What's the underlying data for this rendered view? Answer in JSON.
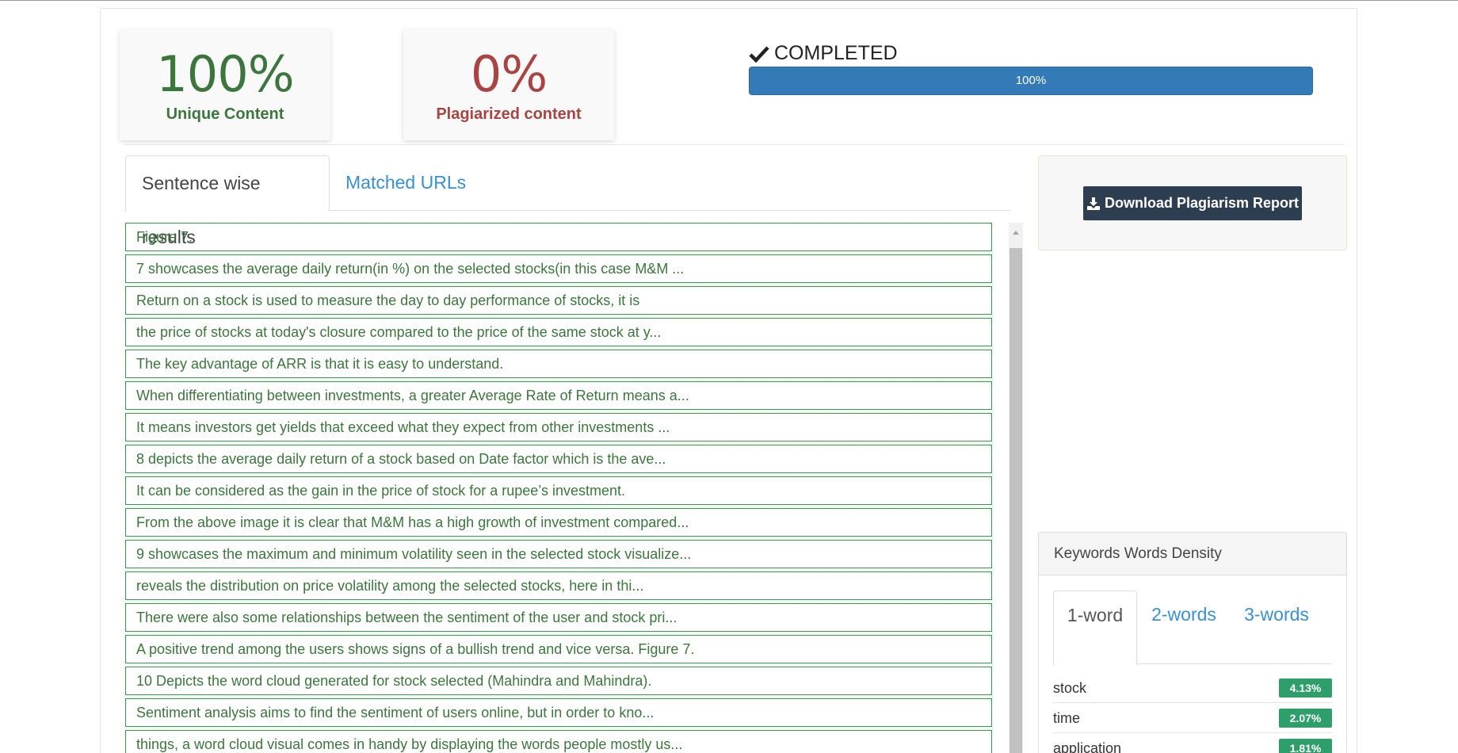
{
  "stats": {
    "unique_pct": "100%",
    "unique_label": "Unique Content",
    "plag_pct": "0%",
    "plag_label": "Plagiarized content"
  },
  "status": {
    "label": "COMPLETED",
    "progress_text": "100%",
    "progress_value": 1.0
  },
  "tabs": {
    "sentence": "Sentence wise results",
    "matched": "Matched URLs"
  },
  "results": [
    "Figure 7.",
    "7 showcases the average daily return(in %) on the selected stocks(in this case M&M ...",
    "Return on a stock is used to measure the day to day performance of stocks, it is",
    "the price of stocks at today's closure compared to the price of the same stock at y...",
    "The key advantage of ARR is that it is easy to understand.",
    "When differentiating between investments, a greater Average Rate of Return means a...",
    "It means investors get yields that exceed what they expect from other investments ...",
    "8 depicts the average daily return of a stock based on Date factor which is the ave...",
    "It can be considered as the gain in the price of stock for a rupee’s investment.",
    "From the above image it is clear that M&M has a high growth of investment compared...",
    "9 showcases the maximum and minimum volatility seen in the selected stock visualize...",
    "reveals the distribution on price volatility among the selected stocks, here in thi...",
    "There were also some relationships between the sentiment of the user and stock pri...",
    "A positive trend among the users shows signs of a bullish trend and vice versa. Figure 7.",
    "10 Depicts the word cloud generated for stock selected (Mahindra and Mahindra).",
    "Sentiment analysis aims to find the sentiment of users online, but in order to kno...",
    "things, a word cloud visual comes in handy by displaying the words people mostly us..."
  ],
  "download": {
    "label": "Download Plagiarism Report"
  },
  "keywords": {
    "title": "Keywords Words Density",
    "tab1": "1-word",
    "tab2": "2-words",
    "tab3": "3-words",
    "rows": [
      {
        "word": "stock",
        "pct": "4.13%"
      },
      {
        "word": "time",
        "pct": "2.07%"
      },
      {
        "word": "application",
        "pct": "1.81%"
      }
    ]
  },
  "colors": {
    "unique": "#3c763d",
    "plagiarized": "#a94442",
    "progress": "#337ab7",
    "badge": "#2e9e6a",
    "download_button": "#2c3e50"
  },
  "icons": [
    "check-icon",
    "download-icon",
    "scroll-up-icon"
  ]
}
